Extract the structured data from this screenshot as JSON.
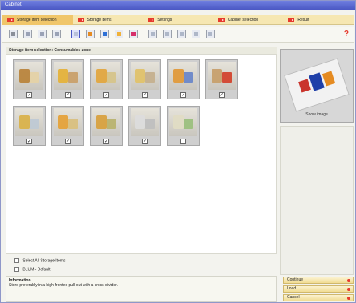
{
  "window": {
    "title": "Cabinet"
  },
  "tabs": [
    {
      "label": "Storage item selection",
      "active": true
    },
    {
      "label": "Storage items",
      "active": false
    },
    {
      "label": "Settings",
      "active": false
    },
    {
      "label": "Cabinet selection",
      "active": false
    },
    {
      "label": "Result",
      "active": false
    }
  ],
  "toolbar": {
    "tools": [
      {
        "icon": "print-icon"
      },
      {
        "icon": "view-icon"
      },
      {
        "icon": "view-icon"
      },
      {
        "icon": "view-icon"
      },
      {
        "icon": "kitchen-icon"
      },
      {
        "icon": "kitchen-icon"
      },
      {
        "icon": "kitchen-icon"
      },
      {
        "icon": "kitchen-icon"
      },
      {
        "icon": "kitchen-icon"
      },
      {
        "icon": "layout-icon"
      },
      {
        "icon": "layout-icon"
      },
      {
        "icon": "layout-icon"
      },
      {
        "icon": "layout-icon"
      },
      {
        "icon": "layout-icon"
      }
    ],
    "help_label": "?"
  },
  "section": {
    "title": "Storage item selection: Consumables zone"
  },
  "items": [
    {
      "checked": true,
      "colors": [
        "#b9853d",
        "#e5d2a6"
      ]
    },
    {
      "checked": true,
      "colors": [
        "#e5b23b",
        "#c9a06a"
      ]
    },
    {
      "checked": true,
      "colors": [
        "#e2a63f",
        "#d6c48a"
      ]
    },
    {
      "checked": true,
      "colors": [
        "#e0c26a",
        "#c5b08e"
      ]
    },
    {
      "checked": true,
      "colors": [
        "#e09a3a",
        "#6c87c8"
      ]
    },
    {
      "checked": true,
      "colors": [
        "#c7a06d",
        "#d3452e"
      ]
    },
    {
      "checked": true,
      "colors": [
        "#d9b24b",
        "#bfc9d4"
      ]
    },
    {
      "checked": true,
      "colors": [
        "#e5a23a",
        "#d9c07f"
      ]
    },
    {
      "checked": true,
      "colors": [
        "#d8a13f",
        "#b9b36f"
      ]
    },
    {
      "checked": true,
      "colors": [
        "#dcdcdc",
        "#bfbfbf"
      ]
    },
    {
      "checked": false,
      "colors": [
        "#e0dcc4",
        "#9cc07e"
      ]
    }
  ],
  "preview": {
    "caption": "Show image"
  },
  "options": {
    "select_all_label": "Select All Storage Items",
    "blum_default_label": "BLUM - Default"
  },
  "info": {
    "title": "Information",
    "text": "Store preferably in a high-fronted pull-out with a cross divider."
  },
  "buttons": {
    "continue": "Continue",
    "load": "Load",
    "cancel": "Cancel"
  },
  "colors": {
    "accent": "#e63a2e",
    "tab_bg": "#f6e7b2",
    "tab_active": "#f0c66a"
  }
}
